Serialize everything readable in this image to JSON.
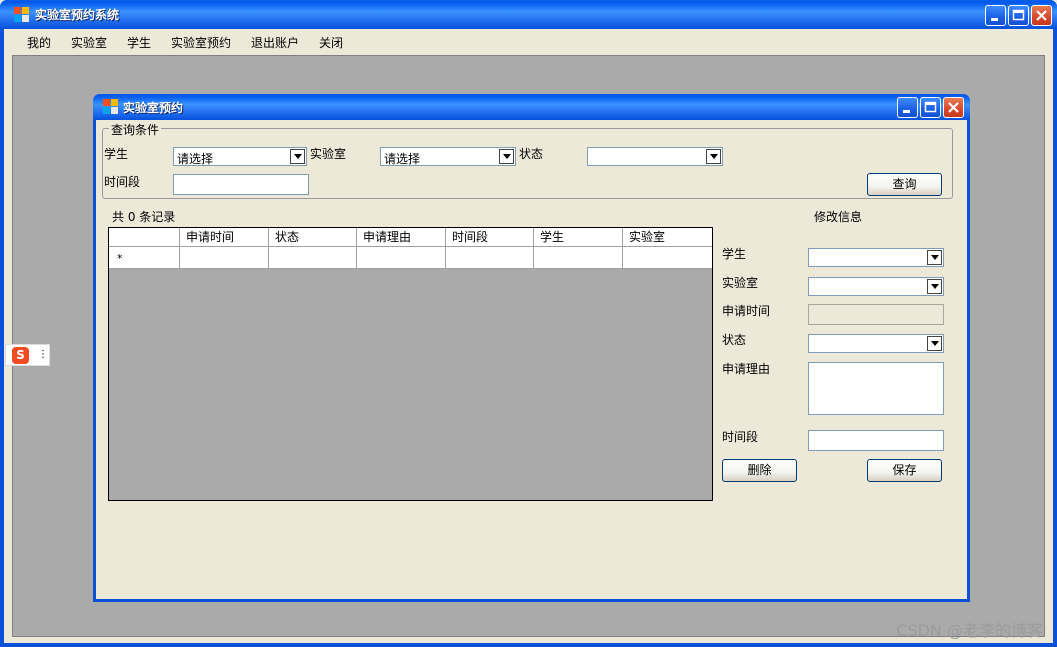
{
  "main_window": {
    "title": "实验室预约系统"
  },
  "menu": {
    "items": [
      {
        "label": "我的"
      },
      {
        "label": "实验室"
      },
      {
        "label": "学生"
      },
      {
        "label": "实验室预约"
      },
      {
        "label": "退出账户"
      },
      {
        "label": "关闭"
      }
    ]
  },
  "child_window": {
    "title": "实验室预约"
  },
  "query": {
    "legend": "查询条件",
    "student_label": "学生",
    "student_value": "请选择",
    "lab_label": "实验室",
    "lab_value": "请选择",
    "status_label": "状态",
    "status_value": "",
    "period_label": "时间段",
    "period_value": "",
    "query_button": "查询"
  },
  "records": {
    "count_text": "共 0 条记录"
  },
  "grid": {
    "columns": [
      "申请时间",
      "状态",
      "申请理由",
      "时间段",
      "学生",
      "实验室"
    ],
    "new_row_marker": "*"
  },
  "edit": {
    "title": "修改信息",
    "student_label": "学生",
    "lab_label": "实验室",
    "apply_time_label": "申请时间",
    "status_label": "状态",
    "reason_label": "申请理由",
    "period_label": "时间段",
    "delete_button": "删除",
    "save_button": "保存"
  },
  "ime": {
    "logo": "S",
    "menu_glyph": "⋮"
  },
  "watermark": "CSDN @老李的博客",
  "colors": {
    "title_bar": "#2470f0",
    "mdi_background": "#aaaaaa",
    "control_face": "#ece9d8",
    "close_button": "#d8482a"
  }
}
